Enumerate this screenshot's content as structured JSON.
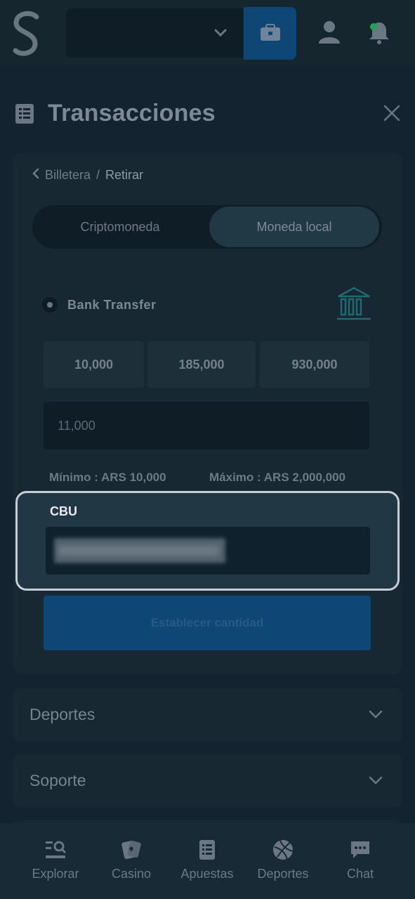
{
  "header": {
    "logo_letter": "S",
    "icons": [
      "chevron-down-icon",
      "wallet-icon",
      "user-icon",
      "bell-icon"
    ]
  },
  "panel": {
    "title": "Transacciones",
    "breadcrumb": {
      "parent": "Billetera",
      "separator": "/",
      "current": "Retirar"
    },
    "tabs": [
      {
        "label": "Criptomoneda",
        "active": false
      },
      {
        "label": "Moneda local",
        "active": true
      }
    ],
    "method": {
      "label": "Bank Transfer",
      "selected": true
    },
    "amount_presets": [
      "10,000",
      "185,000",
      "930,000"
    ],
    "amount_value": "11,000",
    "limits": {
      "min": "Mínimo : ARS 10,000",
      "max": "Máximo : ARS 2,000,000"
    },
    "cbu": {
      "label": "CBU"
    },
    "submit_label": "Establecer cantidad"
  },
  "accordions": [
    {
      "label": "Deportes"
    },
    {
      "label": "Soporte"
    }
  ],
  "bottom_nav": [
    {
      "label": "Explorar",
      "icon": "search-list-icon"
    },
    {
      "label": "Casino",
      "icon": "cards-icon"
    },
    {
      "label": "Apuestas",
      "icon": "betslip-icon"
    },
    {
      "label": "Deportes",
      "icon": "ball-icon"
    },
    {
      "label": "Chat",
      "icon": "chat-icon"
    }
  ],
  "colors": {
    "background": "#13232f",
    "accent_blue": "#0e4676",
    "highlight_border": "#c7ced3",
    "notification_dot": "#1fa550"
  }
}
